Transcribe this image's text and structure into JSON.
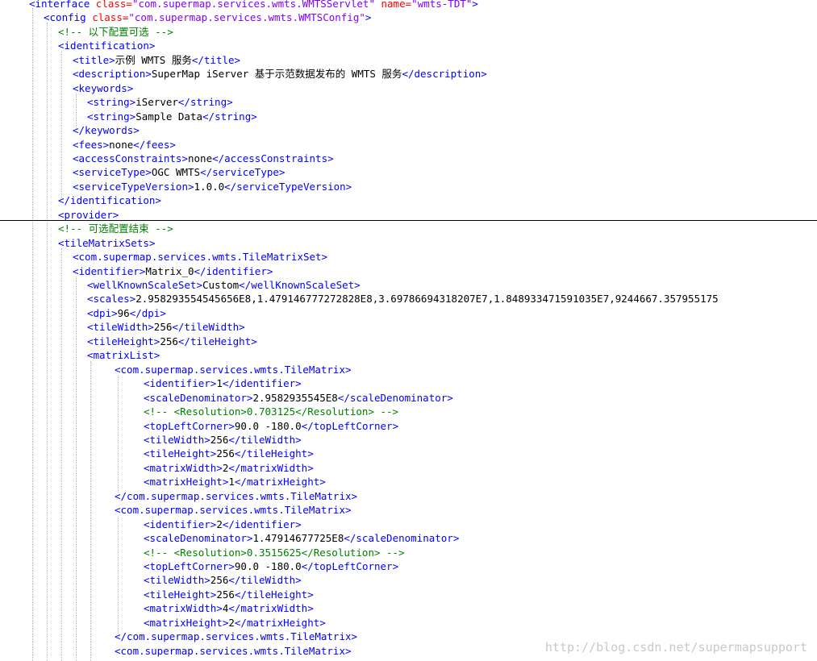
{
  "lines": [
    {
      "indent": 36,
      "parts": [
        {
          "cls": "tag",
          "text": "<interface "
        },
        {
          "cls": "attr",
          "text": "class="
        },
        {
          "cls": "val",
          "text": "\"com.supermap.services.wmts.WMTSServlet\""
        },
        {
          "cls": "attr",
          "text": " name="
        },
        {
          "cls": "val",
          "text": "\"wmts-TDT\""
        },
        {
          "cls": "tag",
          "text": ">"
        }
      ]
    },
    {
      "indent": 54,
      "parts": [
        {
          "cls": "tag",
          "text": "<config "
        },
        {
          "cls": "attr",
          "text": "class="
        },
        {
          "cls": "val",
          "text": "\"com.supermap.services.wmts.WMTSConfig\""
        },
        {
          "cls": "tag",
          "text": ">"
        }
      ]
    },
    {
      "indent": 72,
      "parts": [
        {
          "cls": "cmt",
          "text": "<!-- 以下配置可选 -->"
        }
      ]
    },
    {
      "indent": 72,
      "parts": [
        {
          "cls": "tag",
          "text": "<identification>"
        }
      ]
    },
    {
      "indent": 90,
      "parts": [
        {
          "cls": "tag",
          "text": "<title>"
        },
        {
          "cls": "txt",
          "text": "示例 WMTS 服务"
        },
        {
          "cls": "tag",
          "text": "</title>"
        }
      ]
    },
    {
      "indent": 90,
      "parts": [
        {
          "cls": "tag",
          "text": "<description>"
        },
        {
          "cls": "txt",
          "text": "SuperMap iServer 基于示范数据发布的 WMTS 服务"
        },
        {
          "cls": "tag",
          "text": "</description>"
        }
      ]
    },
    {
      "indent": 90,
      "parts": [
        {
          "cls": "tag",
          "text": "<keywords>"
        }
      ]
    },
    {
      "indent": 108,
      "parts": [
        {
          "cls": "tag",
          "text": "<string>"
        },
        {
          "cls": "txt",
          "text": "iServer"
        },
        {
          "cls": "tag",
          "text": "</string>"
        }
      ]
    },
    {
      "indent": 108,
      "parts": [
        {
          "cls": "tag",
          "text": "<string>"
        },
        {
          "cls": "txt",
          "text": "Sample Data"
        },
        {
          "cls": "tag",
          "text": "</string>"
        }
      ]
    },
    {
      "indent": 90,
      "parts": [
        {
          "cls": "tag",
          "text": "</keywords>"
        }
      ]
    },
    {
      "indent": 90,
      "parts": [
        {
          "cls": "tag",
          "text": "<fees>"
        },
        {
          "cls": "txt",
          "text": "none"
        },
        {
          "cls": "tag",
          "text": "</fees>"
        }
      ]
    },
    {
      "indent": 90,
      "parts": [
        {
          "cls": "tag",
          "text": "<accessConstraints>"
        },
        {
          "cls": "txt",
          "text": "none"
        },
        {
          "cls": "tag",
          "text": "</accessConstraints>"
        }
      ]
    },
    {
      "indent": 90,
      "parts": [
        {
          "cls": "tag",
          "text": "<serviceType>"
        },
        {
          "cls": "txt",
          "text": "OGC WMTS"
        },
        {
          "cls": "tag",
          "text": "</serviceType>"
        }
      ]
    },
    {
      "indent": 90,
      "parts": [
        {
          "cls": "tag",
          "text": "<serviceTypeVersion>"
        },
        {
          "cls": "txt",
          "text": "1.0.0"
        },
        {
          "cls": "tag",
          "text": "</serviceTypeVersion>"
        }
      ]
    },
    {
      "indent": 72,
      "parts": [
        {
          "cls": "tag",
          "text": "</identification>"
        }
      ]
    },
    {
      "indent": 72,
      "parts": [
        {
          "cls": "tag",
          "text": "<provider>"
        }
      ]
    },
    {
      "indent": 72,
      "parts": [
        {
          "cls": "cmt",
          "text": "<!-- 可选配置结束 -->"
        }
      ]
    },
    {
      "indent": 72,
      "parts": [
        {
          "cls": "tag",
          "text": "<tileMatrixSets>"
        }
      ]
    },
    {
      "indent": 90,
      "parts": [
        {
          "cls": "tag",
          "text": "<com.supermap.services.wmts.TileMatrixSet>"
        }
      ]
    },
    {
      "indent": 90,
      "parts": [
        {
          "cls": "tag",
          "text": "<identifier>"
        },
        {
          "cls": "txt",
          "text": "Matrix_0"
        },
        {
          "cls": "tag",
          "text": "</identifier>"
        }
      ]
    },
    {
      "indent": 108,
      "parts": [
        {
          "cls": "tag",
          "text": "<wellKnownScaleSet>"
        },
        {
          "cls": "txt",
          "text": "Custom"
        },
        {
          "cls": "tag",
          "text": "</wellKnownScaleSet>"
        }
      ]
    },
    {
      "indent": 108,
      "parts": [
        {
          "cls": "tag",
          "text": "<scales>"
        },
        {
          "cls": "txt",
          "text": "2.958293554545656E8,1.479146777272828E8,3.69786694318207E7,1.848933471591035E7,9244667.357955175"
        }
      ]
    },
    {
      "indent": 108,
      "parts": [
        {
          "cls": "tag",
          "text": "<dpi>"
        },
        {
          "cls": "txt",
          "text": "96"
        },
        {
          "cls": "tag",
          "text": "</dpi>"
        }
      ]
    },
    {
      "indent": 108,
      "parts": [
        {
          "cls": "tag",
          "text": "<tileWidth>"
        },
        {
          "cls": "txt",
          "text": "256"
        },
        {
          "cls": "tag",
          "text": "</tileWidth>"
        }
      ]
    },
    {
      "indent": 108,
      "parts": [
        {
          "cls": "tag",
          "text": "<tileHeight>"
        },
        {
          "cls": "txt",
          "text": "256"
        },
        {
          "cls": "tag",
          "text": "</tileHeight>"
        }
      ]
    },
    {
      "indent": 108,
      "parts": [
        {
          "cls": "tag",
          "text": "<matrixList>"
        }
      ]
    },
    {
      "indent": 142,
      "parts": [
        {
          "cls": "tag",
          "text": "<com.supermap.services.wmts.TileMatrix>"
        }
      ]
    },
    {
      "indent": 178,
      "parts": [
        {
          "cls": "tag",
          "text": "<identifier>"
        },
        {
          "cls": "txt",
          "text": "1"
        },
        {
          "cls": "tag",
          "text": "</identifier>"
        }
      ]
    },
    {
      "indent": 178,
      "parts": [
        {
          "cls": "tag",
          "text": "<scaleDenominator>"
        },
        {
          "cls": "txt",
          "text": "2.9582935545E8"
        },
        {
          "cls": "tag",
          "text": "</scaleDenominator>"
        }
      ]
    },
    {
      "indent": 178,
      "parts": [
        {
          "cls": "cmt",
          "text": "<!-- <Resolution>0.703125</Resolution> -->"
        }
      ]
    },
    {
      "indent": 178,
      "parts": [
        {
          "cls": "tag",
          "text": "<topLeftCorner>"
        },
        {
          "cls": "txt",
          "text": "90.0 -180.0"
        },
        {
          "cls": "tag",
          "text": "</topLeftCorner>"
        }
      ]
    },
    {
      "indent": 178,
      "parts": [
        {
          "cls": "tag",
          "text": "<tileWidth>"
        },
        {
          "cls": "txt",
          "text": "256"
        },
        {
          "cls": "tag",
          "text": "</tileWidth>"
        }
      ]
    },
    {
      "indent": 178,
      "parts": [
        {
          "cls": "tag",
          "text": "<tileHeight>"
        },
        {
          "cls": "txt",
          "text": "256"
        },
        {
          "cls": "tag",
          "text": "</tileHeight>"
        }
      ]
    },
    {
      "indent": 178,
      "parts": [
        {
          "cls": "tag",
          "text": "<matrixWidth>"
        },
        {
          "cls": "txt",
          "text": "2"
        },
        {
          "cls": "tag",
          "text": "</matrixWidth>"
        }
      ]
    },
    {
      "indent": 178,
      "parts": [
        {
          "cls": "tag",
          "text": "<matrixHeight>"
        },
        {
          "cls": "txt",
          "text": "1"
        },
        {
          "cls": "tag",
          "text": "</matrixHeight>"
        }
      ]
    },
    {
      "indent": 142,
      "parts": [
        {
          "cls": "tag",
          "text": "</com.supermap.services.wmts.TileMatrix>"
        }
      ]
    },
    {
      "indent": 142,
      "parts": [
        {
          "cls": "tag",
          "text": "<com.supermap.services.wmts.TileMatrix>"
        }
      ]
    },
    {
      "indent": 178,
      "parts": [
        {
          "cls": "tag",
          "text": "<identifier>"
        },
        {
          "cls": "txt",
          "text": "2"
        },
        {
          "cls": "tag",
          "text": "</identifier>"
        }
      ]
    },
    {
      "indent": 178,
      "parts": [
        {
          "cls": "tag",
          "text": "<scaleDenominator>"
        },
        {
          "cls": "txt",
          "text": "1.47914677725E8"
        },
        {
          "cls": "tag",
          "text": "</scaleDenominator>"
        }
      ]
    },
    {
      "indent": 178,
      "parts": [
        {
          "cls": "cmt",
          "text": "<!-- <Resolution>0.3515625</Resolution> -->"
        }
      ]
    },
    {
      "indent": 178,
      "parts": [
        {
          "cls": "tag",
          "text": "<topLeftCorner>"
        },
        {
          "cls": "txt",
          "text": "90.0 -180.0"
        },
        {
          "cls": "tag",
          "text": "</topLeftCorner>"
        }
      ]
    },
    {
      "indent": 178,
      "parts": [
        {
          "cls": "tag",
          "text": "<tileWidth>"
        },
        {
          "cls": "txt",
          "text": "256"
        },
        {
          "cls": "tag",
          "text": "</tileWidth>"
        }
      ]
    },
    {
      "indent": 178,
      "parts": [
        {
          "cls": "tag",
          "text": "<tileHeight>"
        },
        {
          "cls": "txt",
          "text": "256"
        },
        {
          "cls": "tag",
          "text": "</tileHeight>"
        }
      ]
    },
    {
      "indent": 178,
      "parts": [
        {
          "cls": "tag",
          "text": "<matrixWidth>"
        },
        {
          "cls": "txt",
          "text": "4"
        },
        {
          "cls": "tag",
          "text": "</matrixWidth>"
        }
      ]
    },
    {
      "indent": 178,
      "parts": [
        {
          "cls": "tag",
          "text": "<matrixHeight>"
        },
        {
          "cls": "txt",
          "text": "2"
        },
        {
          "cls": "tag",
          "text": "</matrixHeight>"
        }
      ]
    },
    {
      "indent": 142,
      "parts": [
        {
          "cls": "tag",
          "text": "</com.supermap.services.wmts.TileMatrix>"
        }
      ]
    },
    {
      "indent": 142,
      "parts": [
        {
          "cls": "tag",
          "text": "<com.supermap.services.wmts.TileMatrix>"
        }
      ]
    }
  ],
  "watermark": "http://blog.csdn.net/supermapsupport",
  "colors": {
    "tag": "#0000ff",
    "attribute": "#ff0000",
    "attribute_value": "#8000ff",
    "text": "#000000",
    "comment": "#008000"
  }
}
